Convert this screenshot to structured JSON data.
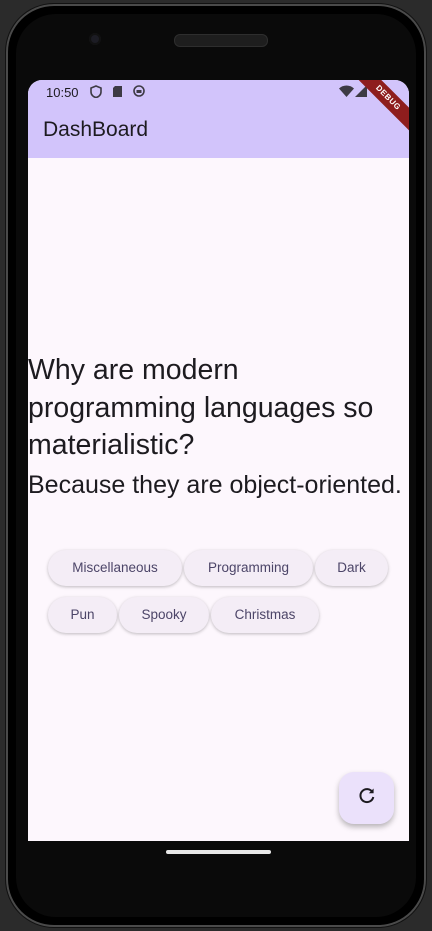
{
  "status": {
    "time": "10:50",
    "icons": [
      "shield-icon",
      "sim-card-icon",
      "vpn-icon",
      "wifi-icon",
      "signal-icon"
    ]
  },
  "appbar": {
    "title": "DashBoard"
  },
  "debug_banner": "DEBUG",
  "joke": {
    "setup": "Why are modern programming languages so materialistic?",
    "delivery": "Because they are object-oriented."
  },
  "categories": [
    "Miscellaneous",
    "Programming",
    "Dark",
    "Pun",
    "Spooky",
    "Christmas"
  ],
  "fab": {
    "icon": "refresh-icon"
  },
  "colors": {
    "appbar": "#d2c4fb",
    "background": "#fdf7fd",
    "chip": "#f4edf6",
    "fab": "#ebe1fb"
  }
}
